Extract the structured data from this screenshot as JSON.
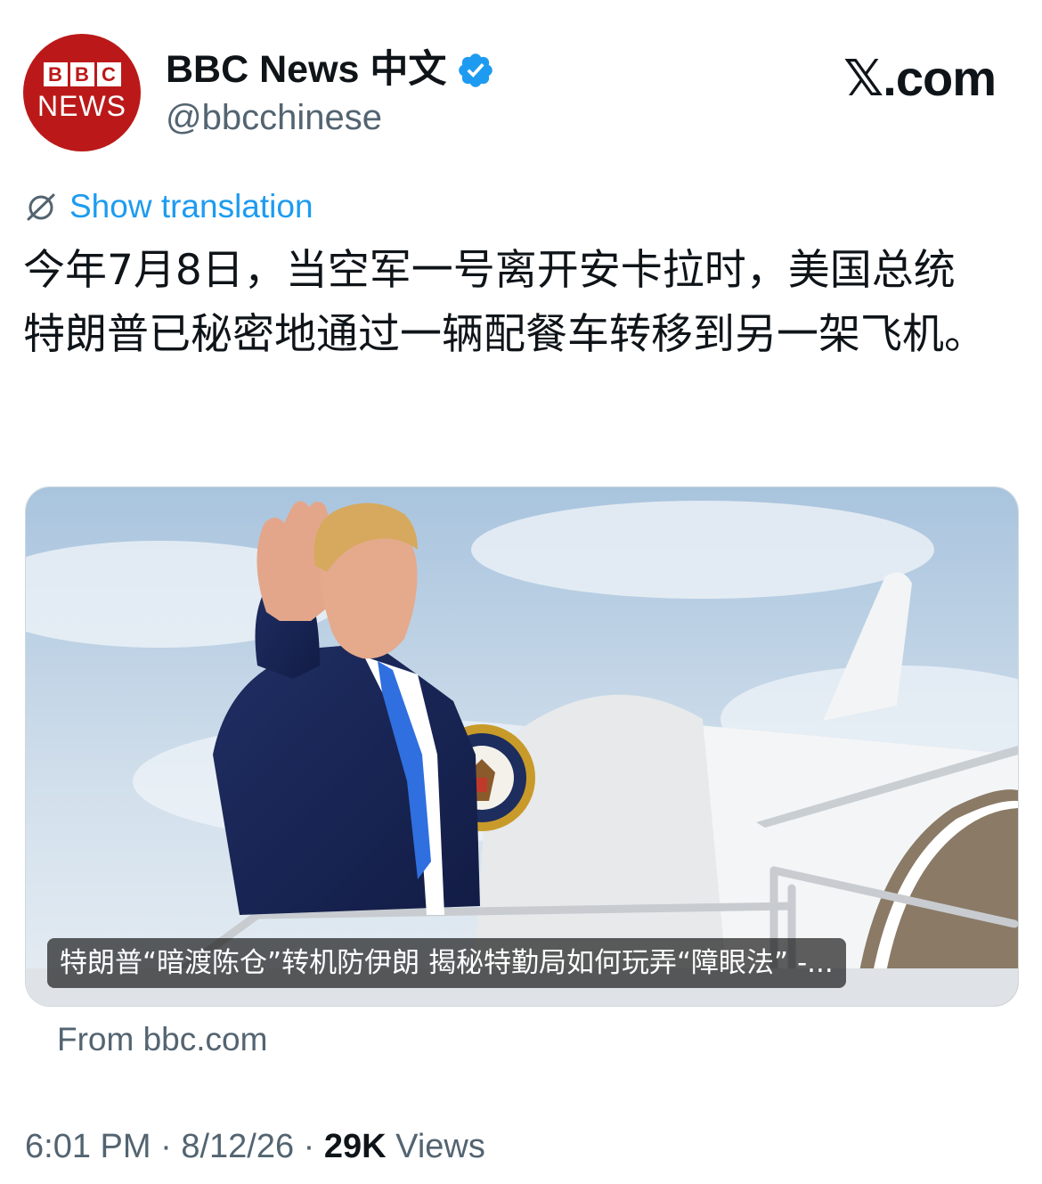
{
  "author": {
    "avatar_logo_top": [
      "B",
      "B",
      "C"
    ],
    "avatar_logo_bottom": "NEWS",
    "name": "BBC News 中文",
    "handle": "@bbcchinese"
  },
  "site_label": "𝕏.com",
  "translate": {
    "label": "Show translation",
    "icon": "translate-icon"
  },
  "tweet_text": "今年7月8日，当空军一号离开安卡拉时，美国总统特朗普已秘密地通过一辆配餐车转移到另一架飞机。",
  "media": {
    "caption": "特朗普“暗渡陈仓”转机防伊朗 揭秘特勤局如何玩弄“障眼法” -...",
    "source": "From bbc.com"
  },
  "meta": {
    "time": "6:01 PM",
    "separator": "·",
    "date": "8/12/26",
    "views_count": "29K",
    "views_label": "Views"
  },
  "colors": {
    "bbc_red": "#bb1919",
    "link_blue": "#1d9bf0",
    "verified_blue": "#1d9bf0",
    "secondary_text": "#536471"
  }
}
